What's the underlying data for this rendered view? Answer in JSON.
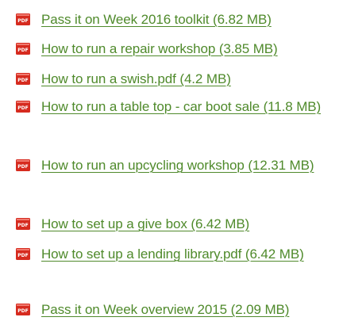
{
  "file_list": {
    "items": [
      {
        "label": "Pass it on Week 2016 toolkit (6.82 MB)",
        "icon": "pdf-icon"
      },
      {
        "label": "How to run a repair workshop (3.85 MB)",
        "icon": "pdf-icon"
      },
      {
        "label": "How to run a swish.pdf (4.2 MB)",
        "icon": "pdf-icon"
      },
      {
        "label": "How to run a table top - car boot sale (11.8 MB)",
        "icon": "pdf-icon"
      },
      {
        "label": "How to run an upcycling workshop (12.31 MB)",
        "icon": "pdf-icon"
      },
      {
        "label": "How to set up a give box (6.42 MB)",
        "icon": "pdf-icon"
      },
      {
        "label": "How to set up a lending library.pdf (6.42 MB)",
        "icon": "pdf-icon"
      },
      {
        "label": "Pass it on Week overview 2015 (2.09 MB)",
        "icon": "pdf-icon"
      }
    ],
    "icon_text": "PDF",
    "link_color": "#4f8a2b",
    "icon_color": "#d62b1f"
  }
}
